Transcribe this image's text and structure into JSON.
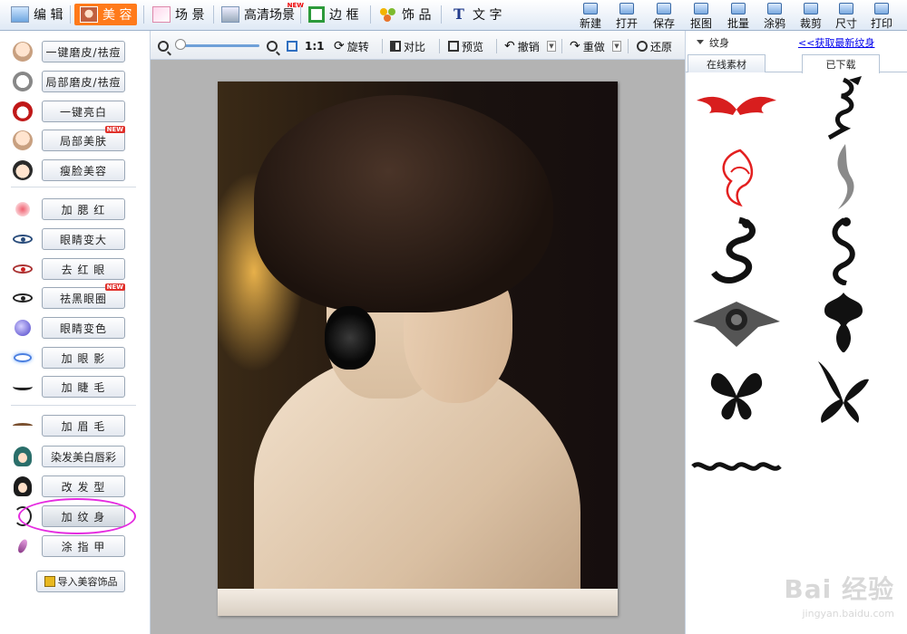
{
  "main_tabs": [
    {
      "label": "编 辑",
      "icon": "image-icon"
    },
    {
      "label": "美 容",
      "icon": "face-icon",
      "active": true
    },
    {
      "label": "场 景",
      "icon": "scene-icon"
    },
    {
      "label": "高清场景",
      "icon": "hd-scene-icon",
      "badge": "NEW"
    },
    {
      "label": "边 框",
      "icon": "frame-icon"
    },
    {
      "label": "饰 品",
      "icon": "decoration-icon"
    },
    {
      "label": "文 字",
      "icon": "text-icon"
    }
  ],
  "toolbar": {
    "new": "新建",
    "open": "打开",
    "save": "保存",
    "cutout": "抠图",
    "batch": "批量",
    "doodle": "涂鸦",
    "crop": "裁剪",
    "size": "尺寸",
    "print": "打印"
  },
  "edit_bar": {
    "zoom_ratio": "1:1",
    "rotate": "旋转",
    "compare": "对比",
    "preview": "预览",
    "undo": "撤销",
    "redo": "重做",
    "restore": "还原"
  },
  "beauty_tools": [
    {
      "label": "一键磨皮/祛痘",
      "icon": "face-icon"
    },
    {
      "label": "局部磨皮/祛痘",
      "icon": "face-sketch-icon"
    },
    {
      "label": "一键亮白",
      "icon": "opera-mask-icon"
    },
    {
      "label": "局部美肤",
      "icon": "face-icon",
      "badge": "NEW"
    },
    {
      "label": "瘦脸美容",
      "icon": "face-dark-icon"
    },
    {
      "label": "加 腮 红",
      "icon": "blush-icon"
    },
    {
      "label": "眼睛变大",
      "icon": "eye-icon"
    },
    {
      "label": "去 红 眼",
      "icon": "red-eye-icon"
    },
    {
      "label": "祛黑眼圈",
      "icon": "dark-eye-icon",
      "badge": "NEW"
    },
    {
      "label": "眼睛变色",
      "icon": "eyeball-icon"
    },
    {
      "label": "加 眼 影",
      "icon": "eyeshadow-icon"
    },
    {
      "label": "加 睫 毛",
      "icon": "eyelash-icon"
    },
    {
      "label": "加 眉 毛",
      "icon": "eyebrow-icon"
    },
    {
      "label": "染发美白唇彩",
      "icon": "hair-dye-icon"
    },
    {
      "label": "改 发 型",
      "icon": "hairstyle-icon"
    },
    {
      "label": "加 纹 身",
      "icon": "tattoo-icon",
      "selected": true
    },
    {
      "label": "涂 指 甲",
      "icon": "nail-polish-icon"
    }
  ],
  "import_button": "导入美容饰品",
  "right_panel": {
    "title": "纹身",
    "get_latest_link": "<<获取最新纹身",
    "tabs": [
      {
        "label": "在线素材"
      },
      {
        "label": "已下载",
        "active": true
      }
    ],
    "items": [
      {
        "name": "red-wings-tattoo"
      },
      {
        "name": "dragon-tribal-tattoo"
      },
      {
        "name": "red-phoenix-tattoo"
      },
      {
        "name": "silver-dragon-tattoo"
      },
      {
        "name": "black-dragon-tattoo"
      },
      {
        "name": "coiled-dragon-tattoo"
      },
      {
        "name": "rose-web-tattoo"
      },
      {
        "name": "tribal-moth-tattoo"
      },
      {
        "name": "butterfly-tattoo"
      },
      {
        "name": "butterfly-tribal-tattoo"
      },
      {
        "name": "tribal-band-tattoo"
      }
    ]
  },
  "watermark": {
    "main": "Bai 经验",
    "sub": "jingyan.baidu.com"
  },
  "colors": {
    "active_tab": "#ff7a1a",
    "highlight_ring": "#e52be0",
    "link": "#0000ee"
  }
}
